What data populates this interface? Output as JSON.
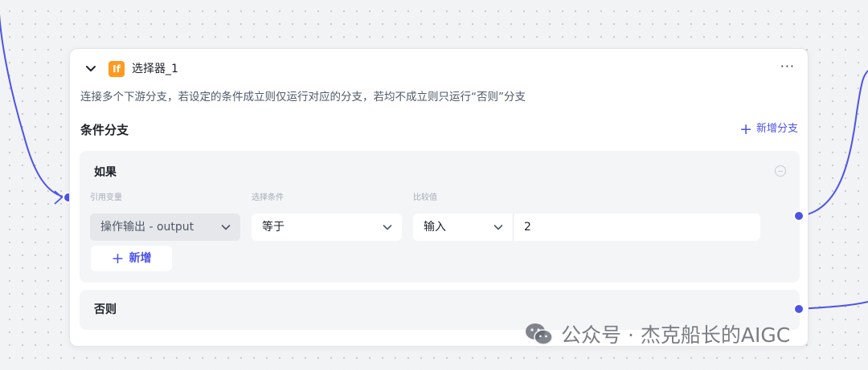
{
  "node": {
    "badge": "If",
    "title": "选择器_1",
    "more_label": "···",
    "description": "连接多个下游分支，若设定的条件成立则仅运行对应的分支，若均不成立则只运行“否则”分支"
  },
  "branches": {
    "title": "条件分支",
    "add_label": "新增分支",
    "if_branch": {
      "title": "如果",
      "labels": {
        "variable": "引用变量",
        "condition": "选择条件",
        "compare": "比较值"
      },
      "condition_row": {
        "variable": "操作输出 - output",
        "condition": "等于",
        "value_type": "输入",
        "value": "2"
      },
      "add_condition_label": "新增"
    },
    "else_branch": {
      "title": "否则"
    }
  },
  "watermark": {
    "text": "公众号 · 杰克船长的AIGC"
  },
  "colors": {
    "accent": "#4d53e8",
    "badge": "#ff9a1f",
    "canvas": "#f2f3f5",
    "panel": "#f4f5f7"
  },
  "icons": [
    "chevron-down-icon",
    "more-icon",
    "plus-icon",
    "minus-circle-icon",
    "wechat-icon"
  ]
}
